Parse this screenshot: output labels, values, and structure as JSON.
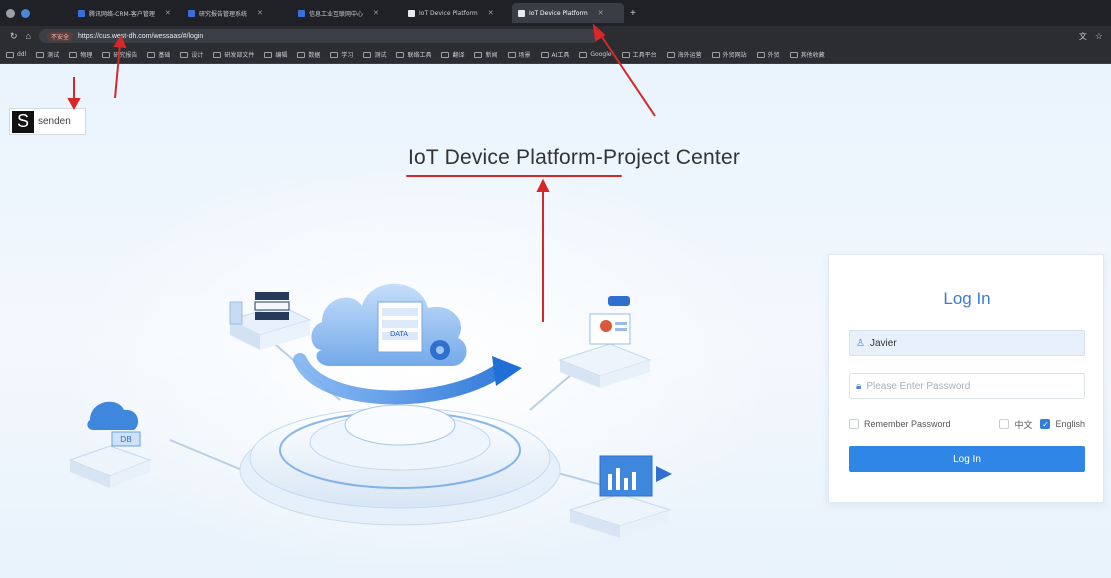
{
  "browser": {
    "tabs": [
      {
        "label": "腾讯网络-CRM-客户管理"
      },
      {
        "label": "研究报告管理系统"
      },
      {
        "label": "信息工业互联网中心"
      },
      {
        "label": "IoT Device Platform"
      },
      {
        "label": "IoT Device Platform",
        "active": true
      }
    ],
    "security_badge": "不安全",
    "url": "https://cus.west-dh.com/wessaas/#/login",
    "bookmarks": [
      "ddl",
      "测试",
      "物理",
      "研究报告",
      "基础",
      "设计",
      "研发部文件",
      "编辑",
      "数据",
      "学习",
      "测试",
      "联络工具",
      "翻译",
      "新闻",
      "场景",
      "AI工具",
      "Google",
      "工具平台",
      "海外运营",
      "外贸网站",
      "外贸",
      "其他收藏"
    ]
  },
  "page": {
    "logo_text": "senden",
    "title": "IoT Device Platform-Project Center",
    "illustration_labels": [
      "DATA",
      "DB"
    ]
  },
  "login": {
    "heading": "Log In",
    "username_value": "Javier",
    "password_placeholder": "Please Enter Password",
    "remember_label": "Remember Password",
    "lang_zh": "中文",
    "lang_en": "English",
    "submit_label": "Log In",
    "remember_checked": false,
    "english_checked": true
  },
  "colors": {
    "accent": "#2f86e6",
    "heading": "#3b7ecf",
    "annotation": "#d62828"
  }
}
